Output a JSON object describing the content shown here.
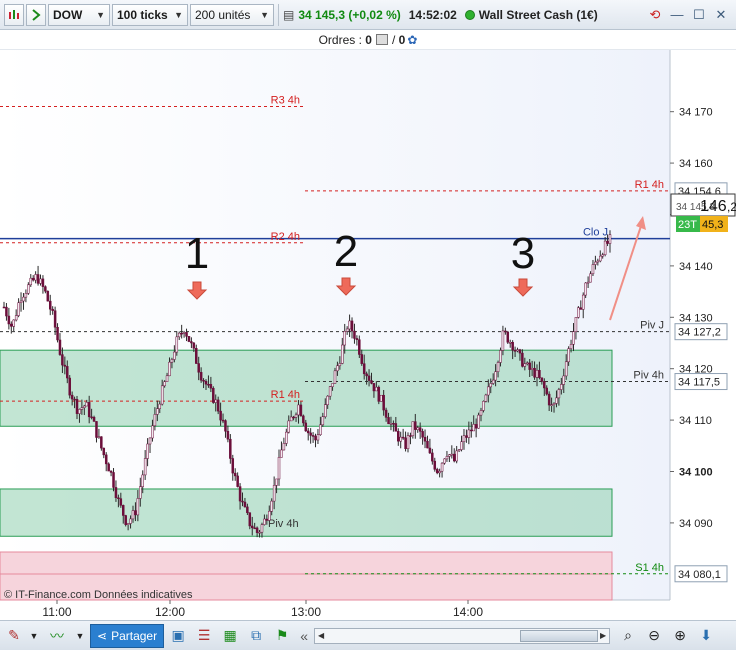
{
  "toolbar": {
    "symbol": "DOW",
    "ticks": "100 ticks",
    "units": "200 unités",
    "price": "34 145,3 (+0,02 %)",
    "time": "14:52:02",
    "instrument": "Wall Street Cash (1€)"
  },
  "orders": {
    "label": "Ordres :",
    "count1": "0",
    "sep": "/",
    "count2": "0"
  },
  "bottombar": {
    "share_label": "Partager"
  },
  "chart_data": {
    "type": "candlestick",
    "y_range": [
      34075,
      34182
    ],
    "y_ticks": [
      34090,
      34100,
      34110,
      34120,
      34130,
      34140,
      34150,
      34160,
      34170
    ],
    "y_tick_labels": [
      "34 090",
      "34 100",
      "34 110",
      "34 120",
      "34 130",
      "34 140",
      "34 150",
      "34 160",
      "34 170"
    ],
    "x_tick_labels": [
      "11:00",
      "12:00",
      "13:00",
      "14:00"
    ],
    "watermark": "© IT-Finance.com Données indicatives",
    "annotations": [
      "1",
      "2",
      "3"
    ],
    "levels": [
      {
        "label": "R3 4h",
        "value": 34171.0,
        "color": "#d42020"
      },
      {
        "label": "R1 4h",
        "value": 34154.6,
        "color": "#d42020",
        "axis": "34 154,6"
      },
      {
        "label": "Clo J",
        "value": 34145.3,
        "color": "#1f3f9a"
      },
      {
        "label": "R2 4h",
        "value": 34144.5,
        "color": "#d42020"
      },
      {
        "label": "Piv J",
        "value": 34127.2,
        "color": "#333333",
        "axis": "34 127,2"
      },
      {
        "label": "Piv 4h",
        "value": 34117.5,
        "color": "#333333",
        "axis": "34 117,5"
      },
      {
        "label": "R1 4h",
        "value": 34113.7,
        "color": "#d42020"
      },
      {
        "label": "Piv 4h",
        "value": 34090.0,
        "color": "#333333"
      },
      {
        "label": "S1 4h",
        "value": 34080.1,
        "color": "#118a11",
        "axis": "34 080,1"
      }
    ],
    "zones": [
      {
        "from": 34108.8,
        "to": 34123.6,
        "color": "#8fcfae"
      },
      {
        "from": 34087.4,
        "to": 34096.6,
        "color": "#8fcfae"
      }
    ],
    "last_price": {
      "main": "146",
      "suffix": ",2",
      "bid": "45,3",
      "bid_tag": "23T",
      "hidden": "34 145,3"
    },
    "close_path": [
      34132,
      34128,
      34134,
      34136,
      34138,
      34135,
      34130,
      34122,
      34116,
      34112,
      34113,
      34109,
      34104,
      34100,
      34094,
      34090,
      34092,
      34100,
      34108,
      34114,
      34119,
      34125,
      34128,
      34124,
      34119,
      34116,
      34113,
      34108,
      34100,
      34094,
      34090,
      34088,
      34091,
      34097,
      34105,
      34110,
      34113,
      34108,
      34106,
      34111,
      34117,
      34122,
      34129,
      34126,
      34120,
      34117,
      34114,
      34110,
      34107,
      34105,
      34109,
      34107,
      34103,
      34100,
      34104,
      34102,
      34106,
      34108,
      34110,
      34115,
      34120,
      34127,
      34125,
      34122,
      34120,
      34119,
      34116,
      34112,
      34117,
      34124,
      34130,
      34136,
      34140,
      34143,
      34145
    ],
    "series_color": "#6b0e3a"
  }
}
